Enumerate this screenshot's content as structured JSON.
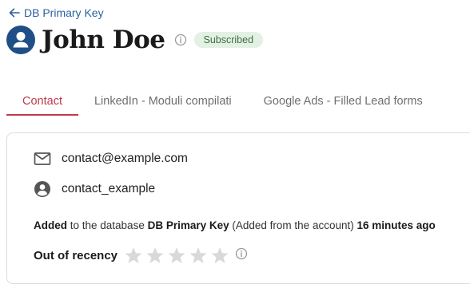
{
  "back": {
    "label": "DB Primary Key",
    "icon": "arrow-left-icon"
  },
  "contact": {
    "name": "John Doe",
    "status_badge": "Subscribed",
    "email": "contact@example.com",
    "username": "contact_example"
  },
  "tabs": [
    {
      "label": "Contact",
      "active": true
    },
    {
      "label": "LinkedIn - Moduli compilati",
      "active": false
    },
    {
      "label": "Google Ads - Filled Lead forms",
      "active": false
    }
  ],
  "added": {
    "verb": "Added",
    "to_text": " to the database ",
    "database": "DB Primary Key",
    "source": " (Added from the account) ",
    "time": "16 minutes ago"
  },
  "recency": {
    "label": "Out of recency",
    "rating": 0,
    "max_rating": 5
  },
  "colors": {
    "accent": "#c0394b",
    "link": "#2b5fa0",
    "avatar_bg": "#1f4f86",
    "badge_bg": "#e3f1e4",
    "badge_text": "#3e6e42"
  }
}
